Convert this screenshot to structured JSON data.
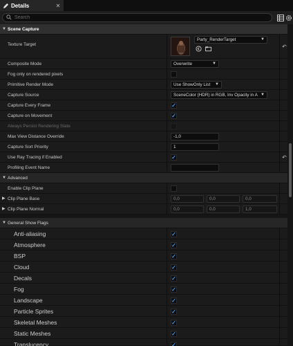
{
  "tab": {
    "title": "Details",
    "icon": "pencil-icon"
  },
  "search": {
    "placeholder": "Search"
  },
  "toolbar": {
    "icons": [
      "table-icon",
      "gear-icon"
    ]
  },
  "sections": {
    "scene_capture": {
      "label": "Scene Capture"
    },
    "advanced": {
      "label": "Advanced"
    },
    "general_show_flags": {
      "label": "General Show Flags"
    }
  },
  "props": {
    "texture_target": {
      "label": "Texture Target",
      "value": "Party_RenderTarget"
    },
    "composite_mode": {
      "label": "Composite Mode",
      "value": "Overwrite"
    },
    "fog_only": {
      "label": "Fog only on rendered pixels",
      "checked": false
    },
    "primitive_render_mode": {
      "label": "Primitive Render Mode",
      "value": "Use ShowOnly List"
    },
    "capture_source": {
      "label": "Capture Source",
      "value": "SceneColor (HDR) in RGB, Inv Opacity in A"
    },
    "capture_every_frame": {
      "label": "Capture Every Frame",
      "checked": true
    },
    "capture_on_movement": {
      "label": "Capture on Movement",
      "checked": true
    },
    "always_persist": {
      "label": "Always Persist Rendering State",
      "checked": false
    },
    "max_view_distance": {
      "label": "Max View Distance Override",
      "value": "-1,0"
    },
    "capture_sort_priority": {
      "label": "Capture Sort Priority",
      "value": "1"
    },
    "use_ray_tracing": {
      "label": "Use Ray Tracing if Enabled",
      "checked": true
    },
    "profiling_event_name": {
      "label": "Profiling Event Name",
      "value": ""
    },
    "enable_clip_plane": {
      "label": "Enable Clip Plane",
      "checked": false
    },
    "clip_plane_base": {
      "label": "Clip Plane Base",
      "values": [
        "0,0",
        "0,0",
        "0,0"
      ]
    },
    "clip_plane_normal": {
      "label": "Clip Plane Normal",
      "values": [
        "0,0",
        "0,0",
        "1,0"
      ]
    }
  },
  "show_flags": [
    {
      "label": "Anti-aliasing",
      "checked": true
    },
    {
      "label": "Atmosphere",
      "checked": true
    },
    {
      "label": "BSP",
      "checked": true
    },
    {
      "label": "Cloud",
      "checked": true
    },
    {
      "label": "Decals",
      "checked": true
    },
    {
      "label": "Fog",
      "checked": true
    },
    {
      "label": "Landscape",
      "checked": true
    },
    {
      "label": "Particle Sprites",
      "checked": true
    },
    {
      "label": "Skeletal Meshes",
      "checked": true
    },
    {
      "label": "Static Meshes",
      "checked": true
    },
    {
      "label": "Translucency",
      "checked": true
    }
  ],
  "colors": {
    "accent": "#3d9bf5",
    "panel": "#1b1b1b",
    "category": "#303030"
  }
}
